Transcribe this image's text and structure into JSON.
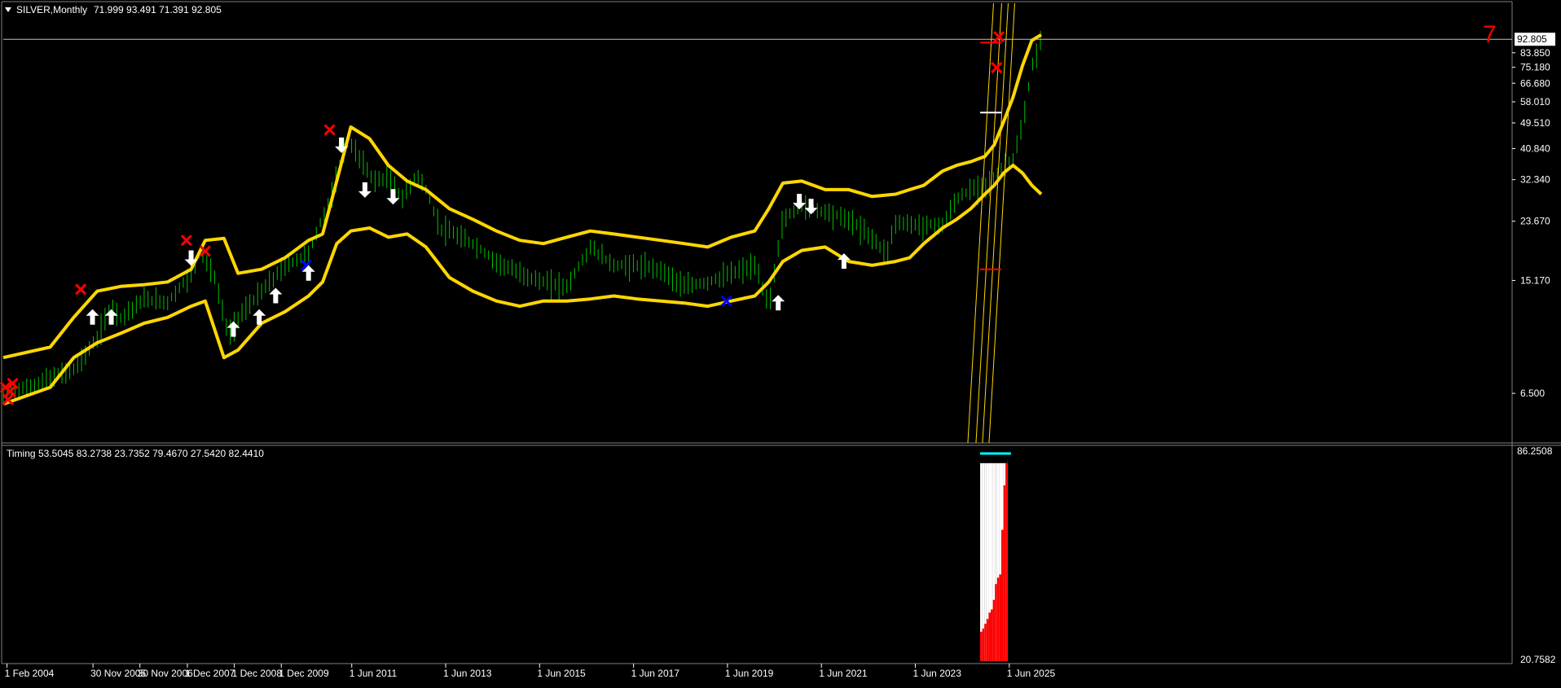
{
  "main_panel": {
    "title": "SILVER,Monthly",
    "ohlc": "71.999 93.491 71.391 92.805",
    "collapse_icon": "triangle-down-icon",
    "corner_count": "7",
    "corner_count_color": "#ff0000"
  },
  "sub_panel": {
    "title": "Timing",
    "values": "53.5045 83.2738 23.7352 79.4670 27.5420 82.4410"
  },
  "colors": {
    "background": "#000000",
    "band": "#ffd700",
    "candle_up": "#00c000",
    "candle_down": "#00c000",
    "cross_marker": "#ff0000",
    "blue_marker": "#0000ff",
    "arrow": "#ffffff",
    "price_line": "#c0c0c0",
    "histogram_red": "#ff0000",
    "histogram_white": "#ffffff",
    "histogram_cap": "#00ffff"
  },
  "chart_data": [
    {
      "type": "line",
      "title": "SILVER,Monthly",
      "ohlc_last": {
        "open": 71.999,
        "high": 93.491,
        "low": 71.391,
        "close": 92.805
      },
      "y_scale": "log",
      "ylim": [
        5.0,
        105.0
      ],
      "y_ticks": [
        "92.805",
        "83.850",
        "75.180",
        "66.680",
        "58.010",
        "49.510",
        "40.840",
        "32.340",
        "23.670",
        "15.170",
        "6.500"
      ],
      "current_price": 92.805,
      "x_ticks": [
        "1 Feb 2004",
        "30 Nov 2005",
        "30 Nov 2006",
        "1 Dec 2007",
        "1 Dec 2008",
        "1 Dec 2009",
        "1 Jun 2011",
        "1 Jun 2013",
        "1 Jun 2015",
        "1 Jun 2017",
        "1 Jun 2019",
        "1 Jun 2021",
        "1 Jun 2023",
        "1 Jun 2025"
      ],
      "x_range": [
        2004.0,
        2026.1
      ],
      "series": [
        {
          "kind": "price",
          "x": [
            2004.0,
            2004.5,
            2005.0,
            2005.5,
            2006.0,
            2006.3,
            2006.5,
            2007.0,
            2007.5,
            2008.0,
            2008.2,
            2008.5,
            2008.8,
            2009.0,
            2009.5,
            2010.0,
            2010.5,
            2010.8,
            2011.0,
            2011.3,
            2011.6,
            2011.9,
            2012.2,
            2012.5,
            2012.8,
            2013.0,
            2013.3,
            2013.6,
            2014.0,
            2014.5,
            2015.0,
            2015.5,
            2016.0,
            2016.5,
            2017.0,
            2017.5,
            2018.0,
            2018.5,
            2019.0,
            2019.5,
            2020.0,
            2020.3,
            2020.6,
            2021.0,
            2021.5,
            2022.0,
            2022.5,
            2022.8,
            2023.0,
            2023.5,
            2024.0,
            2024.3,
            2024.6,
            2024.9,
            2025.1,
            2025.3,
            2025.5,
            2025.7,
            2025.9,
            2026.1
          ],
          "close": [
            6.4,
            6.8,
            7.3,
            7.8,
            9.8,
            12.8,
            11.5,
            13.2,
            12.9,
            16.0,
            19.0,
            15.5,
            10.0,
            11.5,
            14.0,
            17.0,
            18.5,
            24.5,
            28.5,
            44.0,
            38.0,
            32.0,
            33.0,
            28.0,
            33.5,
            30.0,
            22.5,
            21.5,
            20.0,
            17.5,
            16.0,
            15.0,
            14.5,
            19.5,
            17.0,
            17.0,
            16.5,
            14.5,
            15.0,
            16.0,
            17.0,
            12.5,
            24.0,
            26.5,
            25.5,
            24.0,
            21.0,
            18.5,
            23.5,
            23.0,
            23.0,
            28.0,
            30.0,
            31.0,
            32.5,
            36.0,
            38.0,
            48.0,
            75.0,
            92.8
          ]
        },
        {
          "kind": "upper_band",
          "x": [
            2004.0,
            2005.0,
            2005.5,
            2006.0,
            2006.5,
            2007.0,
            2007.5,
            2008.0,
            2008.3,
            2008.7,
            2009.0,
            2009.5,
            2010.0,
            2010.5,
            2010.8,
            2011.1,
            2011.4,
            2011.8,
            2012.2,
            2012.6,
            2013.0,
            2013.5,
            2014.0,
            2014.5,
            2015.0,
            2015.5,
            2016.0,
            2016.5,
            2017.0,
            2017.5,
            2018.0,
            2018.5,
            2019.0,
            2019.5,
            2020.0,
            2020.3,
            2020.6,
            2021.0,
            2021.5,
            2022.0,
            2022.5,
            2023.0,
            2023.3,
            2023.6,
            2024.0,
            2024.3,
            2024.6,
            2024.9,
            2025.1,
            2025.3,
            2025.5,
            2025.7,
            2025.9,
            2026.1
          ],
          "values": [
            8.5,
            9.2,
            11.5,
            14.0,
            14.5,
            14.7,
            15.0,
            16.5,
            20.5,
            20.8,
            16.0,
            16.5,
            18.0,
            20.5,
            21.5,
            32.0,
            48.0,
            44.0,
            36.0,
            32.0,
            30.0,
            26.0,
            24.0,
            22.0,
            20.5,
            20.0,
            21.0,
            22.0,
            21.5,
            21.0,
            20.5,
            20.0,
            19.5,
            21.0,
            22.0,
            26.0,
            31.5,
            32.0,
            30.0,
            30.0,
            28.5,
            29.0,
            30.0,
            31.0,
            34.5,
            36.0,
            37.0,
            38.5,
            42.0,
            50.0,
            60.0,
            76.0,
            92.0,
            96.0
          ]
        },
        {
          "kind": "lower_band",
          "x": [
            2004.0,
            2005.0,
            2005.5,
            2006.0,
            2006.5,
            2007.0,
            2007.5,
            2008.0,
            2008.3,
            2008.7,
            2009.0,
            2009.5,
            2010.0,
            2010.5,
            2010.8,
            2011.1,
            2011.4,
            2011.8,
            2012.2,
            2012.6,
            2013.0,
            2013.5,
            2014.0,
            2014.5,
            2015.0,
            2015.5,
            2016.0,
            2016.5,
            2017.0,
            2017.5,
            2018.0,
            2018.5,
            2019.0,
            2019.5,
            2020.0,
            2020.3,
            2020.6,
            2021.0,
            2021.5,
            2022.0,
            2022.5,
            2023.0,
            2023.3,
            2023.6,
            2024.0,
            2024.3,
            2024.6,
            2024.9,
            2025.1,
            2025.3,
            2025.5,
            2025.7,
            2025.9,
            2026.1
          ],
          "values": [
            6.0,
            6.8,
            8.5,
            9.5,
            10.2,
            11.0,
            11.5,
            12.5,
            13.0,
            8.5,
            9.0,
            11.0,
            12.0,
            13.5,
            15.0,
            20.0,
            22.0,
            22.5,
            21.0,
            21.5,
            19.5,
            15.5,
            14.0,
            13.0,
            12.5,
            13.0,
            13.0,
            13.2,
            13.5,
            13.2,
            13.0,
            12.8,
            12.5,
            13.0,
            13.5,
            15.0,
            17.5,
            19.0,
            19.5,
            17.5,
            17.0,
            17.5,
            18.0,
            20.0,
            22.5,
            24.0,
            26.0,
            29.0,
            31.0,
            34.0,
            36.0,
            34.0,
            31.0,
            29.0
          ]
        }
      ],
      "markers": [
        {
          "kind": "cross",
          "x": 2004.05,
          "y": 6.8
        },
        {
          "kind": "cross",
          "x": 2004.1,
          "y": 6.2
        },
        {
          "kind": "cross",
          "x": 2004.15,
          "y": 6.6
        },
        {
          "kind": "cross",
          "x": 2004.2,
          "y": 7.0
        },
        {
          "kind": "cross",
          "x": 2005.65,
          "y": 14.2
        },
        {
          "kind": "cross",
          "x": 2007.9,
          "y": 20.5
        },
        {
          "kind": "cross",
          "x": 2008.3,
          "y": 18.9
        },
        {
          "kind": "cross",
          "x": 2010.95,
          "y": 47.0
        },
        {
          "kind": "cross",
          "x": 2025.2,
          "y": 94.5
        },
        {
          "kind": "cross",
          "x": 2025.15,
          "y": 75.0
        },
        {
          "kind": "blue_cross",
          "x": 2010.45,
          "y": 17.0
        },
        {
          "kind": "blue_cross",
          "x": 2019.4,
          "y": 13.0
        },
        {
          "kind": "arrow_up",
          "x": 2005.9,
          "y": 11.5
        },
        {
          "kind": "arrow_up",
          "x": 2006.3,
          "y": 11.5
        },
        {
          "kind": "arrow_up",
          "x": 2008.9,
          "y": 10.5
        },
        {
          "kind": "arrow_up",
          "x": 2009.45,
          "y": 11.5
        },
        {
          "kind": "arrow_up",
          "x": 2009.8,
          "y": 13.5
        },
        {
          "kind": "arrow_up",
          "x": 2010.5,
          "y": 16.0
        },
        {
          "kind": "arrow_up",
          "x": 2020.5,
          "y": 12.8
        },
        {
          "kind": "arrow_up",
          "x": 2021.9,
          "y": 17.5
        },
        {
          "kind": "arrow_down",
          "x": 2008.0,
          "y": 18.0
        },
        {
          "kind": "arrow_down",
          "x": 2011.2,
          "y": 42.0
        },
        {
          "kind": "arrow_down",
          "x": 2011.7,
          "y": 30.0
        },
        {
          "kind": "arrow_down",
          "x": 2012.3,
          "y": 28.5
        },
        {
          "kind": "arrow_down",
          "x": 2020.95,
          "y": 27.5
        },
        {
          "kind": "arrow_down",
          "x": 2021.2,
          "y": 26.5
        }
      ]
    },
    {
      "type": "bar",
      "title": "Timing",
      "y_scale": "linear",
      "ylim": [
        20.7582,
        86.2508
      ],
      "y_ticks": [
        "86.2508",
        "20.7582"
      ],
      "legend_values": [
        53.5045,
        83.2738,
        23.7352,
        79.467,
        27.542,
        82.441
      ],
      "x_start": 2024.8,
      "x_step": 0.045,
      "red_values": [
        30.0,
        31.0,
        32.5,
        34.0,
        36.0,
        37.0,
        40.0,
        45.0,
        47.0,
        48.0,
        62.0,
        76.0,
        84.0
      ],
      "white_values": [
        83.0,
        83.0,
        83.0,
        83.0,
        83.0,
        83.0,
        83.0,
        83.0,
        83.0,
        83.0,
        83.0,
        83.0,
        84.0
      ],
      "black_cap": 83.5,
      "cyan_line": 86.0
    }
  ]
}
